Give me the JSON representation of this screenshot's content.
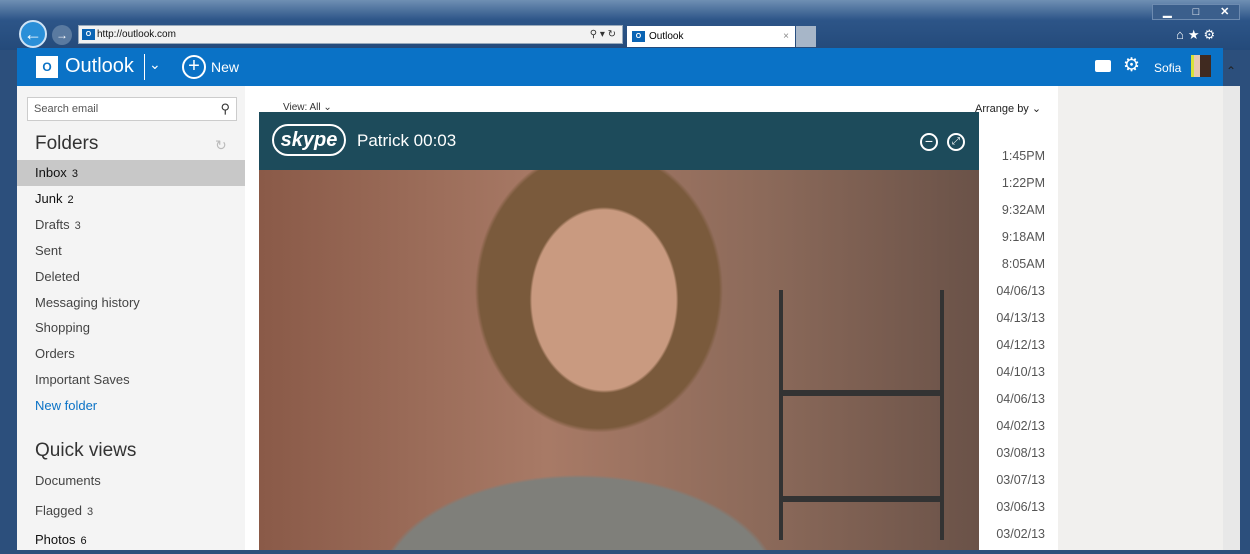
{
  "browser": {
    "url": "http://outlook.com",
    "tab_title": "Outlook",
    "window_buttons": [
      "▁",
      "□",
      "✕"
    ],
    "tools": "⌂★⚙"
  },
  "header": {
    "logo_text": "Outlook",
    "new_label": "New",
    "user_name": "Sofia",
    "brand_color": "#0a72c6"
  },
  "sidebar": {
    "search_placeholder": "Search email",
    "folders_heading": "Folders",
    "folders": [
      {
        "label": "Inbox",
        "count": "3"
      },
      {
        "label": "Junk",
        "count": "2"
      },
      {
        "label": "Drafts",
        "count": "3"
      },
      {
        "label": "Sent",
        "count": ""
      },
      {
        "label": "Deleted",
        "count": ""
      },
      {
        "label": "Messaging history",
        "count": ""
      },
      {
        "label": "Shopping",
        "count": ""
      },
      {
        "label": "Orders",
        "count": ""
      },
      {
        "label": "Important Saves",
        "count": ""
      }
    ],
    "new_folder": "New folder",
    "quick_views_heading": "Quick views",
    "quick_views": [
      {
        "label": "Documents",
        "count": ""
      },
      {
        "label": "Flagged",
        "count": "3"
      },
      {
        "label": "Photos",
        "count": "6"
      }
    ]
  },
  "main": {
    "view_label": "View: All",
    "arrange_label": "Arrange by",
    "times": [
      "1:45PM",
      "1:22PM",
      "9:32AM",
      "9:18AM",
      "8:05AM",
      "04/06/13",
      "04/13/13",
      "04/12/13",
      "04/10/13",
      "04/06/13",
      "04/02/13",
      "03/08/13",
      "03/07/13",
      "03/06/13",
      "03/02/13"
    ]
  },
  "skype": {
    "logo": "skype",
    "caller": "Patrick 00:03",
    "header_color": "#1d4b5b"
  }
}
